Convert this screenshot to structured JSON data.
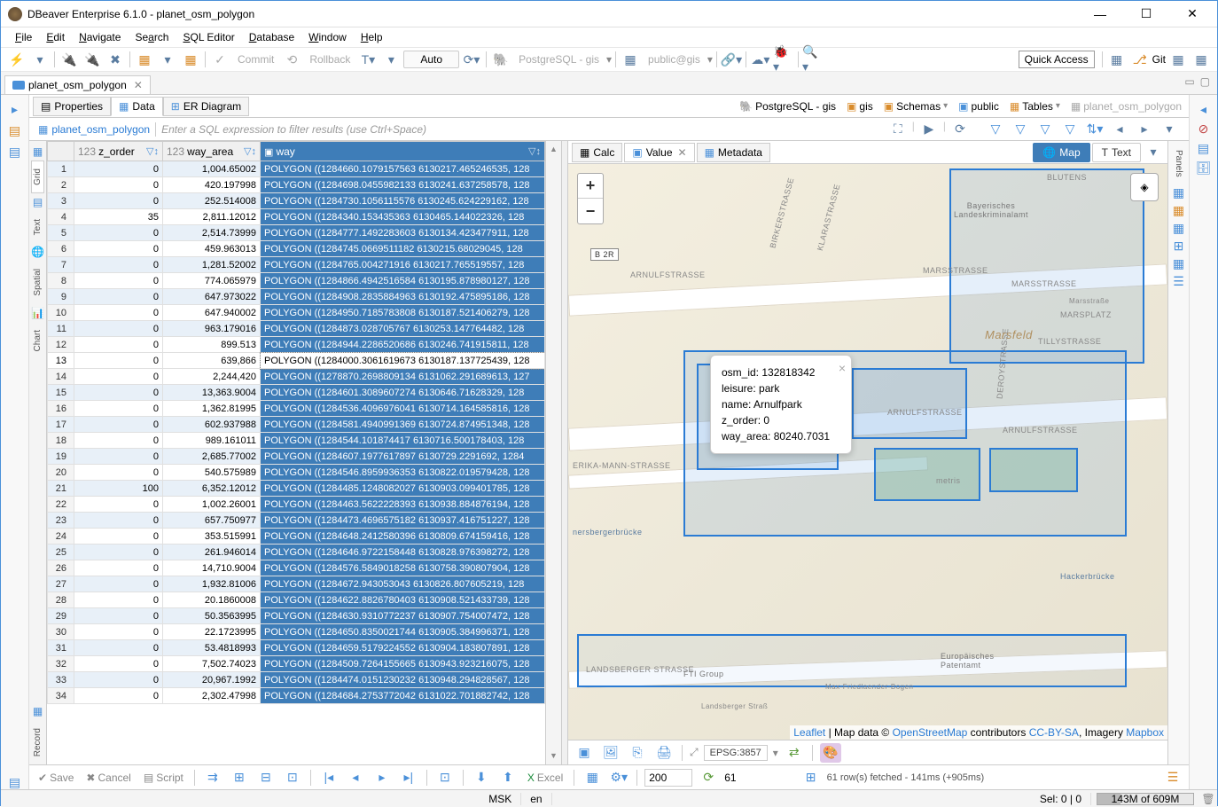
{
  "app": {
    "title": "DBeaver Enterprise 6.1.0 - planet_osm_polygon"
  },
  "menu": {
    "file": "File",
    "edit": "Edit",
    "navigate": "Navigate",
    "search": "Search",
    "sql": "SQL Editor",
    "database": "Database",
    "window": "Window",
    "help": "Help"
  },
  "toolbar": {
    "commit": "Commit",
    "rollback": "Rollback",
    "auto": "Auto",
    "connection": "PostgreSQL - gis",
    "schema": "public@gis",
    "quick": "Quick Access",
    "git": "Git"
  },
  "editorTab": {
    "name": "planet_osm_polygon",
    "close": "✕"
  },
  "subTabs": {
    "properties": "Properties",
    "data": "Data",
    "er": "ER Diagram"
  },
  "breadcrumb": {
    "db": "PostgreSQL - gis",
    "catalog": "gis",
    "schemasFolder": "Schemas",
    "schema": "public",
    "tablesFolder": "Tables",
    "table": "planet_osm_polygon"
  },
  "filter": {
    "placeholder": "Enter a SQL expression to filter results (use Ctrl+Space)",
    "tableName": "planet_osm_polygon"
  },
  "sideTabs": {
    "grid": "Grid",
    "text": "Text",
    "spatial": "Spatial",
    "chart": "Chart",
    "record": "Record"
  },
  "columns": {
    "z_order": "z_order",
    "way_area": "way_area",
    "way": "way",
    "num_prefix": "123",
    "pk_prefix": "123"
  },
  "rows": [
    {
      "n": 1,
      "z": 0,
      "a": "1,004.65002",
      "w": "POLYGON ((1284660.1079157563 6130217.465246535, 128"
    },
    {
      "n": 2,
      "z": 0,
      "a": "420.197998",
      "w": "POLYGON ((1284698.0455982133 6130241.637258578, 128"
    },
    {
      "n": 3,
      "z": 0,
      "a": "252.514008",
      "w": "POLYGON ((1284730.1056115576 6130245.624229162, 128"
    },
    {
      "n": 4,
      "z": 35,
      "a": "2,811.12012",
      "w": "POLYGON ((1284340.153435363 6130465.144022326, 128"
    },
    {
      "n": 5,
      "z": 0,
      "a": "2,514.73999",
      "w": "POLYGON ((1284777.1492283603 6130134.423477911, 128"
    },
    {
      "n": 6,
      "z": 0,
      "a": "459.963013",
      "w": "POLYGON ((1284745.0669511182 6130215.68029045, 128"
    },
    {
      "n": 7,
      "z": 0,
      "a": "1,281.52002",
      "w": "POLYGON ((1284765.004271916 6130217.765519557, 128"
    },
    {
      "n": 8,
      "z": 0,
      "a": "774.065979",
      "w": "POLYGON ((1284866.4942516584 6130195.878980127, 128"
    },
    {
      "n": 9,
      "z": 0,
      "a": "647.973022",
      "w": "POLYGON ((1284908.2835884963 6130192.475895186, 128"
    },
    {
      "n": 10,
      "z": 0,
      "a": "647.940002",
      "w": "POLYGON ((1284950.7185783808 6130187.521406279, 128"
    },
    {
      "n": 11,
      "z": 0,
      "a": "963.179016",
      "w": "POLYGON ((1284873.028705767 6130253.147764482, 128"
    },
    {
      "n": 12,
      "z": 0,
      "a": "899.513",
      "w": "POLYGON ((1284944.2286520686 6130246.741915811, 128"
    },
    {
      "n": 13,
      "z": 0,
      "a": "639,866",
      "w": "POLYGON ((1284000.3061619673 6130187.137725439, 128",
      "current": true
    },
    {
      "n": 14,
      "z": 0,
      "a": "2,244,420",
      "w": "POLYGON ((1278870.2698809134 6131062.291689613, 127"
    },
    {
      "n": 15,
      "z": 0,
      "a": "13,363.9004",
      "w": "POLYGON ((1284601.3089607274 6130646.71628329, 128"
    },
    {
      "n": 16,
      "z": 0,
      "a": "1,362.81995",
      "w": "POLYGON ((1284536.4096976041 6130714.164585816, 128"
    },
    {
      "n": 17,
      "z": 0,
      "a": "602.937988",
      "w": "POLYGON ((1284581.4940991369 6130724.874951348, 128"
    },
    {
      "n": 18,
      "z": 0,
      "a": "989.161011",
      "w": "POLYGON ((1284544.101874417 6130716.500178403, 128"
    },
    {
      "n": 19,
      "z": 0,
      "a": "2,685.77002",
      "w": "POLYGON ((1284607.1977617897 6130729.2291692, 1284"
    },
    {
      "n": 20,
      "z": 0,
      "a": "540.575989",
      "w": "POLYGON ((1284546.8959936353 6130822.019579428, 128"
    },
    {
      "n": 21,
      "z": 100,
      "a": "6,352.12012",
      "w": "POLYGON ((1284485.1248082027 6130903.099401785, 128"
    },
    {
      "n": 22,
      "z": 0,
      "a": "1,002.26001",
      "w": "POLYGON ((1284463.5622228393 6130938.884876194, 128"
    },
    {
      "n": 23,
      "z": 0,
      "a": "657.750977",
      "w": "POLYGON ((1284473.4696575182 6130937.416751227, 128"
    },
    {
      "n": 24,
      "z": 0,
      "a": "353.515991",
      "w": "POLYGON ((1284648.2412580396 6130809.674159416, 128"
    },
    {
      "n": 25,
      "z": 0,
      "a": "261.946014",
      "w": "POLYGON ((1284646.9722158448 6130828.976398272, 128"
    },
    {
      "n": 26,
      "z": 0,
      "a": "14,710.9004",
      "w": "POLYGON ((1284576.5849018258 6130758.390807904, 128"
    },
    {
      "n": 27,
      "z": 0,
      "a": "1,932.81006",
      "w": "POLYGON ((1284672.943053043 6130826.807605219, 128"
    },
    {
      "n": 28,
      "z": 0,
      "a": "20.1860008",
      "w": "POLYGON ((1284622.8826780403 6130908.521433739, 128"
    },
    {
      "n": 29,
      "z": 0,
      "a": "50.3563995",
      "w": "POLYGON ((1284630.9310772237 6130907.754007472, 128"
    },
    {
      "n": 30,
      "z": 0,
      "a": "22.1723995",
      "w": "POLYGON ((1284650.8350021744 6130905.384996371, 128"
    },
    {
      "n": 31,
      "z": 0,
      "a": "53.4818993",
      "w": "POLYGON ((1284659.5179224552 6130904.183807891, 128"
    },
    {
      "n": 32,
      "z": 0,
      "a": "7,502.74023",
      "w": "POLYGON ((1284509.7264155665 6130943.923216075, 128"
    },
    {
      "n": 33,
      "z": 0,
      "a": "20,967.1992",
      "w": "POLYGON ((1284474.0151230232 6130948.294828567, 128"
    },
    {
      "n": 34,
      "z": 0,
      "a": "2,302.47998",
      "w": "POLYGON ((1284684.2753772042 6131022.701882742, 128"
    }
  ],
  "mapTabs": {
    "calc": "Calc",
    "value": "Value",
    "metadata": "Metadata",
    "map": "Map",
    "text": "Text"
  },
  "popup": {
    "osm_id": "osm_id: 132818342",
    "leisure": "leisure: park",
    "name": "name: Arnulfpark",
    "z_order": "z_order: 0",
    "way_area": "way_area: 80240.7031"
  },
  "roads": {
    "arnulf": "ARNULFSTRASSE",
    "mars": "MARSSTRASSE",
    "landsberger": "LANDSBERGER STRASSE",
    "erika": "ERIKA-MANN-STRASSE",
    "blutenburg": "BLUTENS",
    "birker": "BIRKERSTRASSE",
    "klara": "KLARASTRASSE",
    "tilly": "TILLYSTRASSE",
    "deroy": "DEROYSTRASSE",
    "marsplatz": "MARSPLATZ",
    "marsfeld": "Marsfeld",
    "b2r": "B 2R",
    "hacker": "Hackerbrücke",
    "donners": "nersbergerbrücke",
    "fti": "FTI Group",
    "patent": "Europäisches\nPatentamt",
    "mfl": "Max-Friedlaender-Bogen",
    "blk": "Bayerisches\nLandeskriminalamt",
    "landsberger2": "Landsberger Straß",
    "metris": "metris",
    "marsstr2": "Marsstraße"
  },
  "attribution": {
    "leaflet": "Leaflet",
    "sep": " | Map data © ",
    "osm": "OpenStreetMap",
    "contrib": " contributors ",
    "cc": "CC-BY-SA",
    "imagery": ", Imagery ",
    "mapbox": "Mapbox"
  },
  "mapToolbar": {
    "epsg": "EPSG:3857"
  },
  "bottom": {
    "save": "Save",
    "cancel": "Cancel",
    "script": "Script",
    "excel": "Excel",
    "page": "200",
    "total": "61",
    "fetch": "61 row(s) fetched - 141ms (+905ms)"
  },
  "status": {
    "msk": "MSK",
    "en": "en",
    "sel": "Sel: 0 | 0",
    "mem": "143M of 609M"
  },
  "rightPanel": {
    "panels": "Panels"
  }
}
